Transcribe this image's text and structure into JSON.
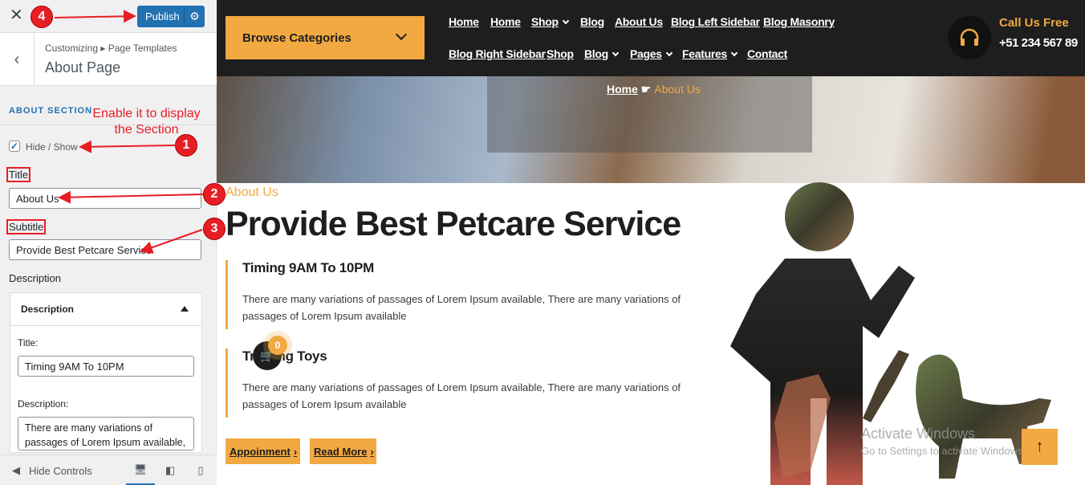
{
  "customizer": {
    "close_icon": "close-icon",
    "publish_label": "Publish",
    "settings_icon": "gear-icon",
    "breadcrumb_small": "Customizing ▸ Page Templates",
    "breadcrumb_title": "About Page",
    "section_label": "ABOUT SECTION",
    "hide_show_label": "Hide / Show",
    "hide_show_checked": true,
    "title_label": "Title",
    "title_value": "About Us",
    "subtitle_label": "Subtitle",
    "subtitle_value": "Provide Best Petcare Service",
    "description_label": "Description",
    "desc_box_header": "Description",
    "desc_title_label": "Title:",
    "desc_title_value": "Timing 9AM To 10PM",
    "desc_desc_label": "Description:",
    "desc_desc_value": "There are many variations of passages of Lorem Ipsum available,",
    "footer_hide_controls": "Hide Controls"
  },
  "annotations": {
    "m1": "1",
    "m2": "2",
    "m3": "3",
    "m4": "4",
    "note_line1": "Enable it to display",
    "note_line2": "the Section"
  },
  "site": {
    "browse_label": "Browse Categories",
    "nav_row1": [
      "Home",
      "Home",
      "Shop",
      "Blog",
      "About Us",
      "Blog Left Sidebar",
      "Blog Masonry"
    ],
    "nav_row2": [
      "Blog Right Sidebar",
      "Shop",
      "Blog",
      "Pages",
      "Features",
      "Contact"
    ],
    "call_label": "Call Us Free",
    "call_number": "+51 234 567 89",
    "breadcrumb_home": "Home",
    "breadcrumb_current": "About Us",
    "eyebrow": "About Us",
    "heading": "Provide Best Petcare Service",
    "item1_title": "Timing 9AM To 10PM",
    "item1_text": "There are many variations of passages of Lorem Ipsum available, There are many variations of passages of Lorem Ipsum available",
    "item2_title": "Training Toys",
    "item2_text": "There are many variations of passages of Lorem Ipsum available, There are many variations of passages of Lorem Ipsum available",
    "btn_appoinment": "Appoinment",
    "btn_readmore": "Read More",
    "cart_count": "0",
    "watermark_title": "Activate Windows",
    "watermark_sub": "Go to Settings to activate Windows.",
    "accent_color": "#f2a942"
  }
}
